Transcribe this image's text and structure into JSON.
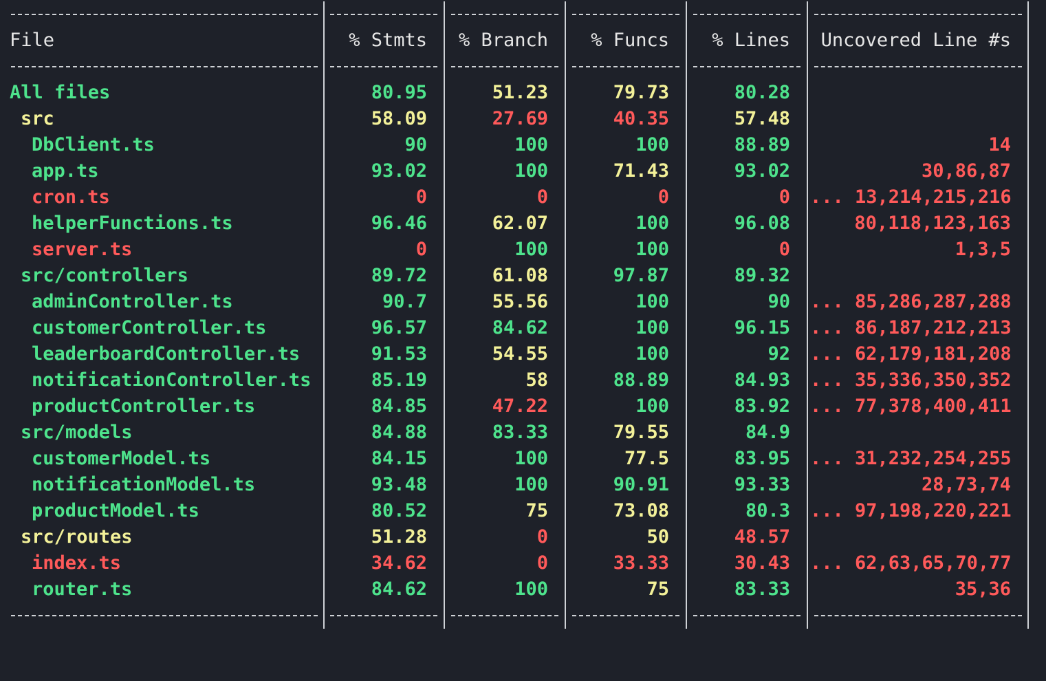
{
  "colors": {
    "background": "#1e2129",
    "text": "#d6d6d6",
    "green": "#4ee38c",
    "yellow": "#f3f199",
    "red": "#ff5a5a"
  },
  "header": {
    "file": "File",
    "stmts": "% Stmts",
    "branch": "% Branch",
    "funcs": "% Funcs",
    "lines": "% Lines",
    "uncovered": "Uncovered Line #s"
  },
  "rows": [
    {
      "file": "All files",
      "level": 0,
      "file_color": "green",
      "stmts": "80.95",
      "stmts_color": "green",
      "branch": "51.23",
      "branch_color": "yellow",
      "funcs": "79.73",
      "funcs_color": "yellow",
      "lines": "80.28",
      "lines_color": "green",
      "uncovered": ""
    },
    {
      "file": "src",
      "level": 1,
      "file_color": "yellow",
      "stmts": "58.09",
      "stmts_color": "yellow",
      "branch": "27.69",
      "branch_color": "red",
      "funcs": "40.35",
      "funcs_color": "red",
      "lines": "57.48",
      "lines_color": "yellow",
      "uncovered": ""
    },
    {
      "file": "DbClient.ts",
      "level": 2,
      "file_color": "green",
      "stmts": "90",
      "stmts_color": "green",
      "branch": "100",
      "branch_color": "green",
      "funcs": "100",
      "funcs_color": "green",
      "lines": "88.89",
      "lines_color": "green",
      "uncovered": "14"
    },
    {
      "file": "app.ts",
      "level": 2,
      "file_color": "green",
      "stmts": "93.02",
      "stmts_color": "green",
      "branch": "100",
      "branch_color": "green",
      "funcs": "71.43",
      "funcs_color": "yellow",
      "lines": "93.02",
      "lines_color": "green",
      "uncovered": "30,86,87"
    },
    {
      "file": "cron.ts",
      "level": 2,
      "file_color": "red",
      "stmts": "0",
      "stmts_color": "red",
      "branch": "0",
      "branch_color": "red",
      "funcs": "0",
      "funcs_color": "red",
      "lines": "0",
      "lines_color": "red",
      "uncovered": "... 13,214,215,216"
    },
    {
      "file": "helperFunctions.ts",
      "level": 2,
      "file_color": "green",
      "stmts": "96.46",
      "stmts_color": "green",
      "branch": "62.07",
      "branch_color": "yellow",
      "funcs": "100",
      "funcs_color": "green",
      "lines": "96.08",
      "lines_color": "green",
      "uncovered": "80,118,123,163"
    },
    {
      "file": "server.ts",
      "level": 2,
      "file_color": "red",
      "stmts": "0",
      "stmts_color": "red",
      "branch": "100",
      "branch_color": "green",
      "funcs": "100",
      "funcs_color": "green",
      "lines": "0",
      "lines_color": "red",
      "uncovered": "1,3,5"
    },
    {
      "file": "src/controllers",
      "level": 1,
      "file_color": "green",
      "stmts": "89.72",
      "stmts_color": "green",
      "branch": "61.08",
      "branch_color": "yellow",
      "funcs": "97.87",
      "funcs_color": "green",
      "lines": "89.32",
      "lines_color": "green",
      "uncovered": ""
    },
    {
      "file": "adminController.ts",
      "level": 2,
      "file_color": "green",
      "stmts": "90.7",
      "stmts_color": "green",
      "branch": "55.56",
      "branch_color": "yellow",
      "funcs": "100",
      "funcs_color": "green",
      "lines": "90",
      "lines_color": "green",
      "uncovered": "... 85,286,287,288"
    },
    {
      "file": "customerController.ts",
      "level": 2,
      "file_color": "green",
      "stmts": "96.57",
      "stmts_color": "green",
      "branch": "84.62",
      "branch_color": "green",
      "funcs": "100",
      "funcs_color": "green",
      "lines": "96.15",
      "lines_color": "green",
      "uncovered": "... 86,187,212,213"
    },
    {
      "file": "leaderboardController.ts",
      "level": 2,
      "file_color": "green",
      "stmts": "91.53",
      "stmts_color": "green",
      "branch": "54.55",
      "branch_color": "yellow",
      "funcs": "100",
      "funcs_color": "green",
      "lines": "92",
      "lines_color": "green",
      "uncovered": "... 62,179,181,208"
    },
    {
      "file": "notificationController.ts",
      "level": 2,
      "file_color": "green",
      "stmts": "85.19",
      "stmts_color": "green",
      "branch": "58",
      "branch_color": "yellow",
      "funcs": "88.89",
      "funcs_color": "green",
      "lines": "84.93",
      "lines_color": "green",
      "uncovered": "... 35,336,350,352"
    },
    {
      "file": "productController.ts",
      "level": 2,
      "file_color": "green",
      "stmts": "84.85",
      "stmts_color": "green",
      "branch": "47.22",
      "branch_color": "red",
      "funcs": "100",
      "funcs_color": "green",
      "lines": "83.92",
      "lines_color": "green",
      "uncovered": "... 77,378,400,411"
    },
    {
      "file": "src/models",
      "level": 1,
      "file_color": "green",
      "stmts": "84.88",
      "stmts_color": "green",
      "branch": "83.33",
      "branch_color": "green",
      "funcs": "79.55",
      "funcs_color": "yellow",
      "lines": "84.9",
      "lines_color": "green",
      "uncovered": ""
    },
    {
      "file": "customerModel.ts",
      "level": 2,
      "file_color": "green",
      "stmts": "84.15",
      "stmts_color": "green",
      "branch": "100",
      "branch_color": "green",
      "funcs": "77.5",
      "funcs_color": "yellow",
      "lines": "83.95",
      "lines_color": "green",
      "uncovered": "... 31,232,254,255"
    },
    {
      "file": "notificationModel.ts",
      "level": 2,
      "file_color": "green",
      "stmts": "93.48",
      "stmts_color": "green",
      "branch": "100",
      "branch_color": "green",
      "funcs": "90.91",
      "funcs_color": "green",
      "lines": "93.33",
      "lines_color": "green",
      "uncovered": "28,73,74"
    },
    {
      "file": "productModel.ts",
      "level": 2,
      "file_color": "green",
      "stmts": "80.52",
      "stmts_color": "green",
      "branch": "75",
      "branch_color": "yellow",
      "funcs": "73.08",
      "funcs_color": "yellow",
      "lines": "80.3",
      "lines_color": "green",
      "uncovered": "... 97,198,220,221"
    },
    {
      "file": "src/routes",
      "level": 1,
      "file_color": "yellow",
      "stmts": "51.28",
      "stmts_color": "yellow",
      "branch": "0",
      "branch_color": "red",
      "funcs": "50",
      "funcs_color": "yellow",
      "lines": "48.57",
      "lines_color": "red",
      "uncovered": ""
    },
    {
      "file": "index.ts",
      "level": 2,
      "file_color": "red",
      "stmts": "34.62",
      "stmts_color": "red",
      "branch": "0",
      "branch_color": "red",
      "funcs": "33.33",
      "funcs_color": "red",
      "lines": "30.43",
      "lines_color": "red",
      "uncovered": "... 62,63,65,70,77"
    },
    {
      "file": "router.ts",
      "level": 2,
      "file_color": "green",
      "stmts": "84.62",
      "stmts_color": "green",
      "branch": "100",
      "branch_color": "green",
      "funcs": "75",
      "funcs_color": "yellow",
      "lines": "83.33",
      "lines_color": "green",
      "uncovered": "35,36"
    }
  ]
}
